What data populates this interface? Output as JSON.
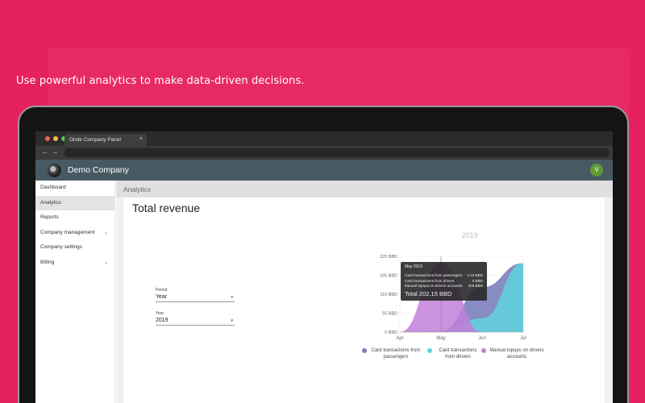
{
  "tagline": "Use powerful analytics to make data-driven decisions.",
  "browser": {
    "tab_title": "Onde Company Panel",
    "tab_close": "×",
    "back": "←",
    "forward": "→"
  },
  "appbar": {
    "company": "Demo Company",
    "avatar_initial": "V"
  },
  "sidebar": {
    "items": [
      {
        "label": "Dashboard"
      },
      {
        "label": "Analytics"
      },
      {
        "label": "Reports"
      },
      {
        "label": "Company management"
      },
      {
        "label": "Company settings"
      },
      {
        "label": "Billing"
      }
    ],
    "active": "Analytics",
    "chevron": "⌄"
  },
  "breadcrumb": "Analytics",
  "card_title": "Total revenue",
  "filters": {
    "period_label": "Period",
    "period_value": "Year",
    "year_label": "Year",
    "year_value": "2019",
    "caret": "▾"
  },
  "tooltip": {
    "date": "May 2019",
    "rows": [
      {
        "label": "Card transactions from passengers",
        "value": "2.15 BBD"
      },
      {
        "label": "Card transactions from drivers",
        "value": "0 BBD"
      },
      {
        "label": "Manual topups on drivers accounts",
        "value": "200 BBD"
      }
    ],
    "total": "Total 202.15 BBD"
  },
  "colors": {
    "accent": "#e6215f",
    "appbar": "#475a63",
    "passengers": "#7a7fbd",
    "drivers": "#5fd3dd",
    "topups": "#c17fd9"
  },
  "chart_data": {
    "type": "area",
    "title": "2019",
    "categories": [
      "Apr",
      "May",
      "Jun",
      "Jul"
    ],
    "yticks": [
      "0 BBD",
      "55 BBD",
      "110 BBD",
      "165 BBD",
      "220 BBD"
    ],
    "ylim": [
      0,
      220
    ],
    "series": [
      {
        "name": "Card transactions from passengers",
        "values": [
          0,
          2.15,
          130,
          200
        ]
      },
      {
        "name": "Card transactions from drivers",
        "values": [
          0,
          0,
          40,
          200
        ]
      },
      {
        "name": "Manual topups on drivers accounts",
        "values": [
          0,
          200,
          0,
          0
        ]
      }
    ],
    "legend": "bottom"
  }
}
